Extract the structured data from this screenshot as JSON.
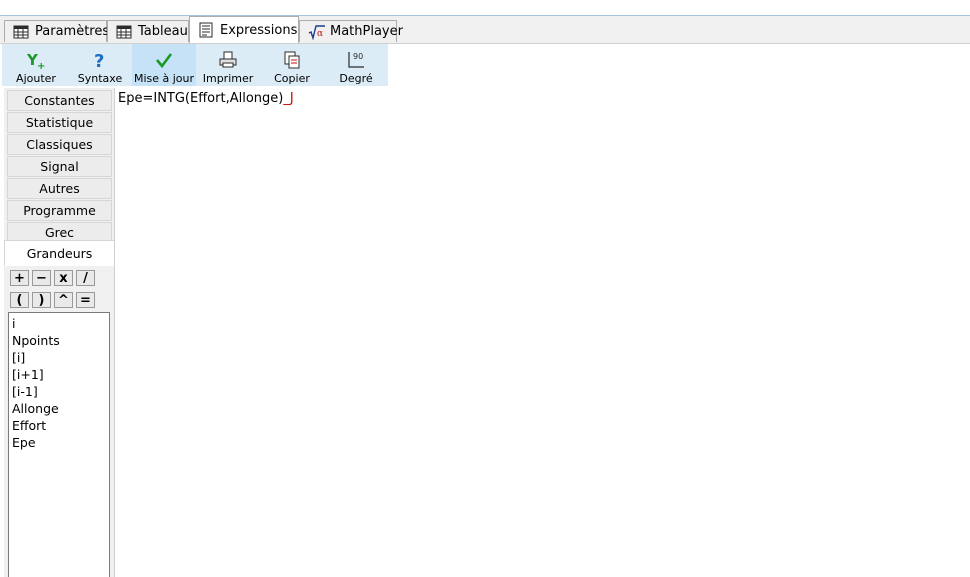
{
  "tabs": [
    {
      "label": "Paramètres",
      "icon": "grid-icon"
    },
    {
      "label": "Tableau",
      "icon": "grid-icon"
    },
    {
      "label": "Expressions",
      "icon": "document-icon"
    },
    {
      "label": "MathPlayer",
      "icon": "sqrt-alpha-icon"
    }
  ],
  "active_tab": "Expressions",
  "toolbar": {
    "buttons": [
      {
        "label": "Ajouter",
        "icon": "y-plus-icon"
      },
      {
        "label": "Syntaxe",
        "icon": "question-icon"
      },
      {
        "label": "Mise à jour",
        "icon": "checkmark-icon"
      },
      {
        "label": "Imprimer",
        "icon": "printer-icon"
      },
      {
        "label": "Copier",
        "icon": "copy-icon"
      },
      {
        "label": "Degré",
        "icon": "angle-degree-icon"
      }
    ],
    "degree_icon_text": "90"
  },
  "categories": [
    "Constantes",
    "Statistique",
    "Classiques",
    "Signal",
    "Autres",
    "Programme",
    "Grec"
  ],
  "active_category": "Grandeurs",
  "operators": [
    "+",
    "−",
    "x",
    "/",
    "(",
    ")",
    "^",
    "="
  ],
  "variables": [
    "i",
    "Npoints",
    "[i]",
    "[i+1]",
    "[i-1]",
    "Allonge",
    "Effort",
    "Epe"
  ],
  "editor": {
    "expression": "Epe=INTG(Effort,Allonge)",
    "cursor": "_J"
  },
  "colors": {
    "toolbar_bg": "#dcecf6",
    "toolbar_highlight": "#c6e2f6",
    "icon_green": "#1a9a2a",
    "icon_blue": "#1b6fc4",
    "caret_red": "#d00000"
  }
}
